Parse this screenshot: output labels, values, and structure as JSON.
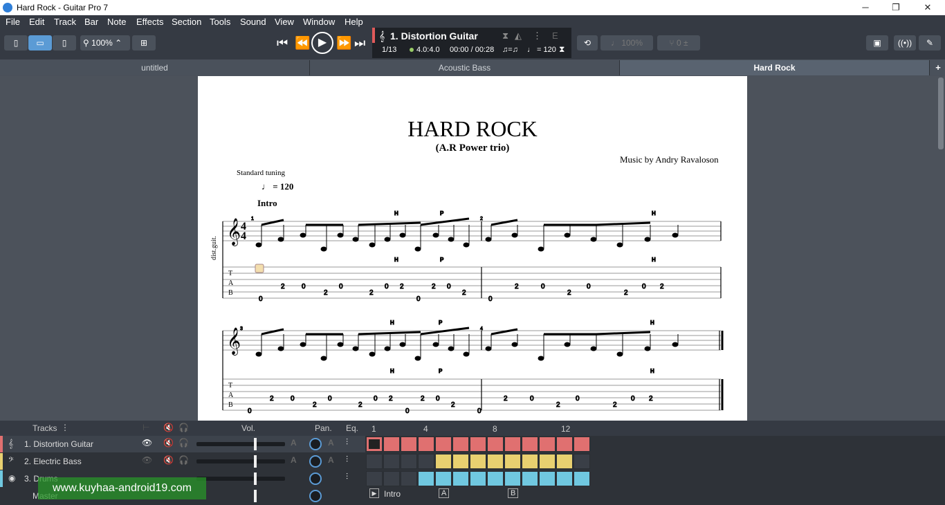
{
  "window": {
    "title": "Hard Rock - Guitar Pro 7",
    "minimize": "─",
    "maximize": "❐",
    "close": "✕"
  },
  "menu": [
    "File",
    "Edit",
    "Track",
    "Bar",
    "Note",
    "Effects",
    "Section",
    "Tools",
    "Sound",
    "View",
    "Window",
    "Help"
  ],
  "toolbar": {
    "zoom": "100%"
  },
  "lcd": {
    "track": "1. Distortion Guitar",
    "bar": "1/13",
    "signature": "4.0:4.0",
    "time": "00:00 / 00:28",
    "tempo_label": "♩ = 120",
    "triplet": "♫=♫",
    "key": "E",
    "speed": "100%",
    "tune_value": "0"
  },
  "tabs": [
    {
      "label": "untitled"
    },
    {
      "label": "Acoustic Bass"
    },
    {
      "label": "Hard Rock"
    }
  ],
  "score": {
    "title": "HARD ROCK",
    "subtitle": "(A.R Power trio)",
    "credits": "Music by Andry Ravaloson",
    "tuning": "Standard tuning",
    "tempo": "= 120",
    "section": "Intro",
    "track_short": "dist.guit.",
    "time_sig": "4\n4",
    "bar_numbers": [
      "1",
      "2",
      "3",
      "4"
    ],
    "technique_h": "H",
    "technique_p": "P"
  },
  "tracks_panel": {
    "header": "Tracks",
    "vol": "Vol.",
    "pan": "Pan.",
    "eq": "Eq.",
    "ruler": [
      "1",
      "4",
      "8",
      "12"
    ],
    "rows": [
      {
        "name": "1. Distortion Guitar",
        "color": "#e07070"
      },
      {
        "name": "2. Electric Bass",
        "color": "#e8d070"
      },
      {
        "name": "3. Drums",
        "color": "#70c8e0"
      },
      {
        "name": "Master",
        "color": "#2e3238"
      }
    ],
    "markers": [
      "Intro",
      "A",
      "B"
    ]
  },
  "watermark": "www.kuyhaa-android19.com"
}
